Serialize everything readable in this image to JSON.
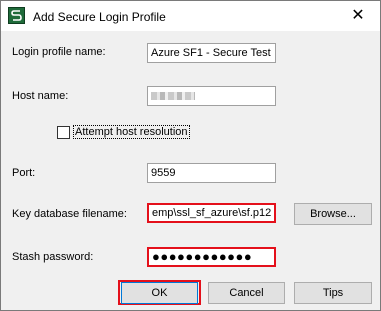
{
  "window": {
    "title": "Add Secure Login Profile",
    "close_glyph": "✕"
  },
  "form": {
    "login_profile_name": {
      "label": "Login profile name:",
      "value": "Azure SF1 - Secure Test"
    },
    "host_name": {
      "label": "Host name:",
      "value": ""
    },
    "attempt_host_resolution": {
      "label": "Attempt host resolution",
      "checked": false
    },
    "port": {
      "label": "Port:",
      "value": "9559"
    },
    "key_database_filename": {
      "label": "Key database filename:",
      "value": "emp\\ssl_sf_azure\\sf.p12"
    },
    "stash_password": {
      "label": "Stash password:",
      "value": "●●●●●●●●●●●●"
    }
  },
  "buttons": {
    "browse": "Browse...",
    "ok": "OK",
    "cancel": "Cancel",
    "tips": "Tips"
  },
  "colors": {
    "highlight": "#e4101b",
    "app_icon": "#1f6b3a"
  },
  "icons": {
    "app": "app-logo-icon",
    "close": "close-icon",
    "checkbox": "checkbox-icon"
  }
}
